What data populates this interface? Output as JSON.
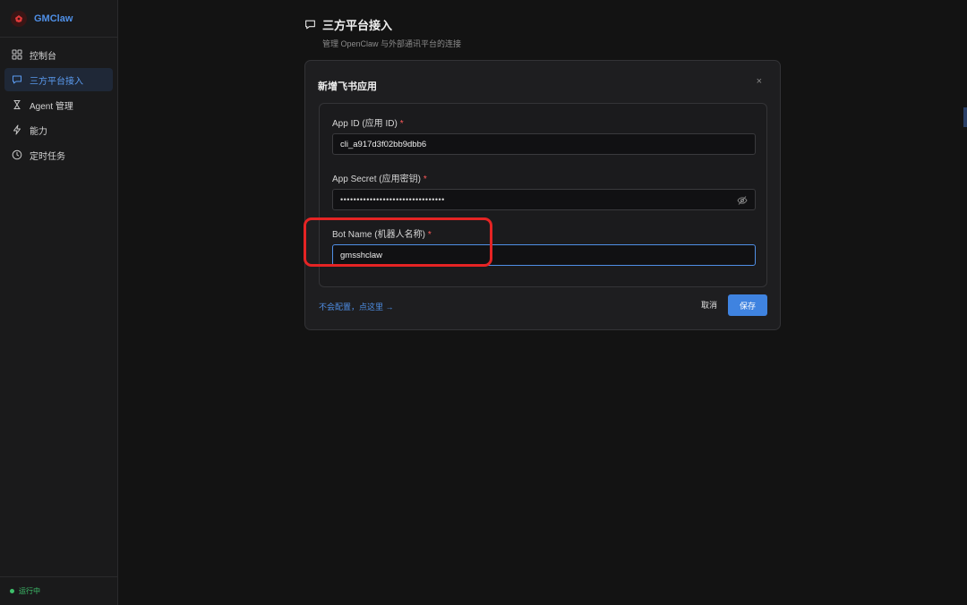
{
  "app": {
    "name": "GMClaw"
  },
  "sidebar": {
    "items": [
      {
        "label": "控制台",
        "icon": "grid-icon",
        "active": false
      },
      {
        "label": "三方平台接入",
        "icon": "chat-bubble-icon",
        "active": true
      },
      {
        "label": "Agent 管理",
        "icon": "agent-icon",
        "active": false
      },
      {
        "label": "能力",
        "icon": "lightning-icon",
        "active": false
      },
      {
        "label": "定时任务",
        "icon": "clock-icon",
        "active": false
      }
    ],
    "status": "运行中"
  },
  "page": {
    "title": "三方平台接入",
    "subtitle": "管理 OpenClaw 与外部通讯平台的连接"
  },
  "modal": {
    "title": "新增飞书应用",
    "close": "×",
    "fields": [
      {
        "label": "App ID (应用 ID)",
        "required": "*",
        "value": "cli_a917d3f02bb9dbb6"
      },
      {
        "label": "App Secret (应用密钥)",
        "required": "*",
        "value": "••••••••••••••••••••••••••••••••"
      },
      {
        "label": "Bot Name (机器人名称)",
        "required": "*",
        "value": "gmsshclaw"
      }
    ],
    "help_link": "不会配置，点这里 →",
    "cancel_label": "取消",
    "save_label": "保存"
  },
  "colors": {
    "accent": "#3f83e0",
    "highlight": "#e52424",
    "status": "#3ec06b"
  }
}
